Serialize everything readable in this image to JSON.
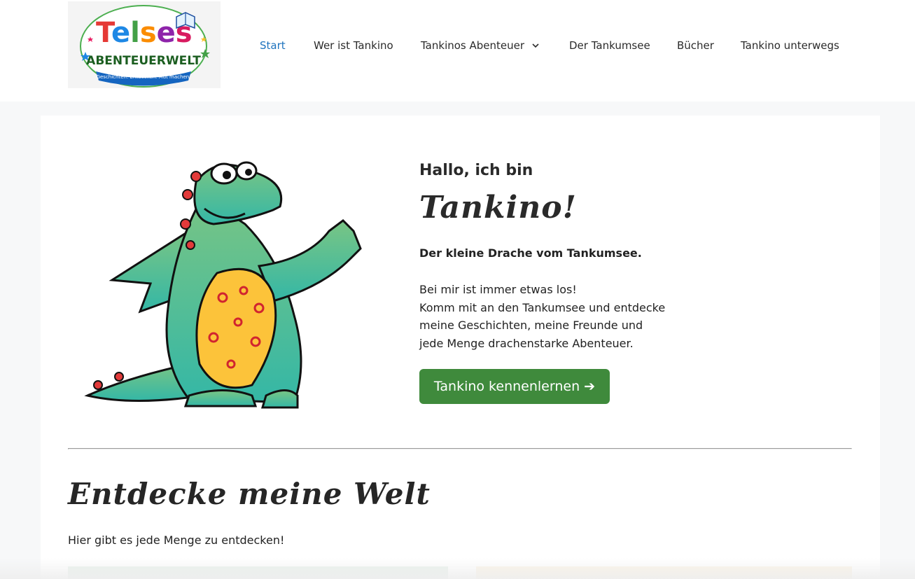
{
  "logo": {
    "wordmark": "Telses",
    "subtitle": "ABENTEUERWELT",
    "tagline": "Geschichten. Entdecken. Mut machen."
  },
  "nav": {
    "items": [
      {
        "label": "Start",
        "active": true
      },
      {
        "label": "Wer ist Tankino"
      },
      {
        "label": "Tankinos Abenteuer",
        "icon": "chevron-down-icon"
      },
      {
        "label": "Der Tankumsee"
      },
      {
        "label": "Bücher"
      },
      {
        "label": "Tankino unterwegs"
      }
    ]
  },
  "hero": {
    "greeting": "Hallo, ich bin",
    "name": "Tankino!",
    "subline": "Der kleine Drache vom Tankumsee.",
    "body_lines": [
      "Bei mir ist immer etwas los!",
      "Komm mit an den Tankumsee und entdecke",
      "meine Geschichten, meine Freunde und",
      "jede Menge drachenstarke Abenteuer."
    ],
    "cta_label": "Tankino kennenlernen ➔"
  },
  "section": {
    "title": "Entdecke meine Welt",
    "text": "Hier gibt es jede Menge zu entdecken!"
  },
  "colors": {
    "nav_active": "#1e73be",
    "cta_bg": "#3f8a3c",
    "page_bg": "#f7f8f9"
  }
}
